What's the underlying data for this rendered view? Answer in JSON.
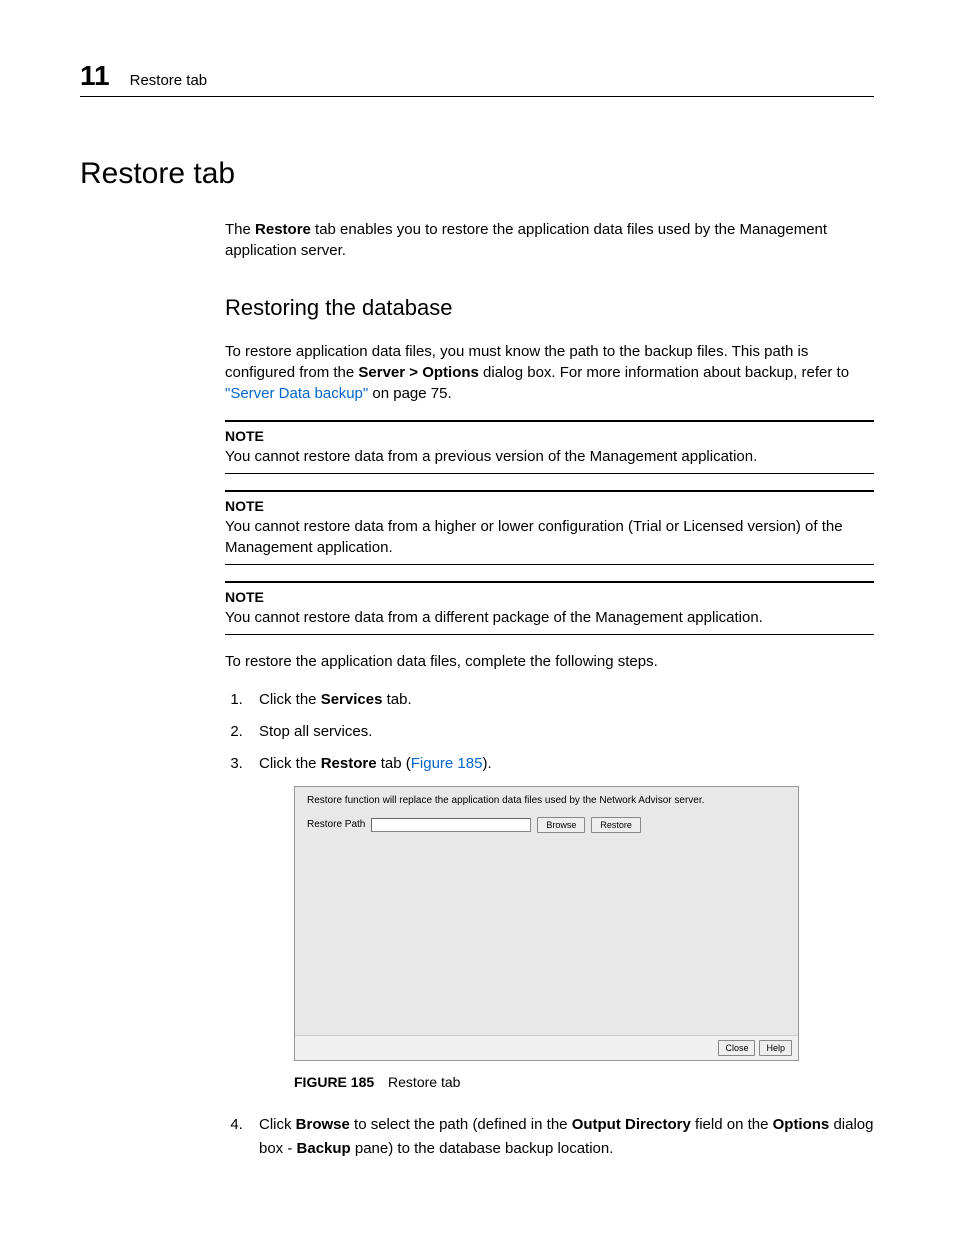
{
  "header": {
    "chapter_number": "11",
    "running_title": "Restore tab"
  },
  "title": "Restore tab",
  "intro": {
    "pre": "The ",
    "bold": "Restore",
    "post": " tab enables you to restore the application data files used by the Management application server."
  },
  "section_heading": "Restoring the database",
  "section_intro": {
    "line1": "To restore application data files, you must know the path to the backup files. This path is configured from the ",
    "bold": "Server > Options",
    "line1b": " dialog box. For more information about backup, refer to ",
    "link": "\"Server Data backup\"",
    "line1c": " on page 75."
  },
  "notes": [
    {
      "label": "NOTE",
      "text": "You cannot restore data from a previous version of the Management application."
    },
    {
      "label": "NOTE",
      "text": "You cannot restore data from a higher or lower configuration (Trial or Licensed version) of the Management application."
    },
    {
      "label": "NOTE",
      "text": "You cannot restore data from a different package of the Management application."
    }
  ],
  "steps_intro": "To restore the application data files, complete the following steps.",
  "steps": {
    "s1": {
      "pre": "Click the ",
      "bold": "Services",
      "post": " tab."
    },
    "s2": {
      "text": "Stop all services."
    },
    "s3": {
      "pre": "Click the ",
      "bold": "Restore",
      "post": " tab (",
      "link": "Figure 185",
      "post2": ")."
    },
    "s4": {
      "pre": "Click ",
      "b1": "Browse",
      "mid1": " to select the path (defined in the ",
      "b2": "Output Directory",
      "mid2": " field on the ",
      "b3": "Options",
      "mid3": " dialog box - ",
      "b4": "Backup",
      "post": " pane) to the database backup location."
    }
  },
  "figure": {
    "desc": "Restore function will replace the application data files used by the Network Advisor server.",
    "row_label": "Restore Path",
    "browse": "Browse",
    "restore": "Restore",
    "close": "Close",
    "help": "Help",
    "caption_label": "FIGURE 185",
    "caption_text": "Restore tab"
  }
}
